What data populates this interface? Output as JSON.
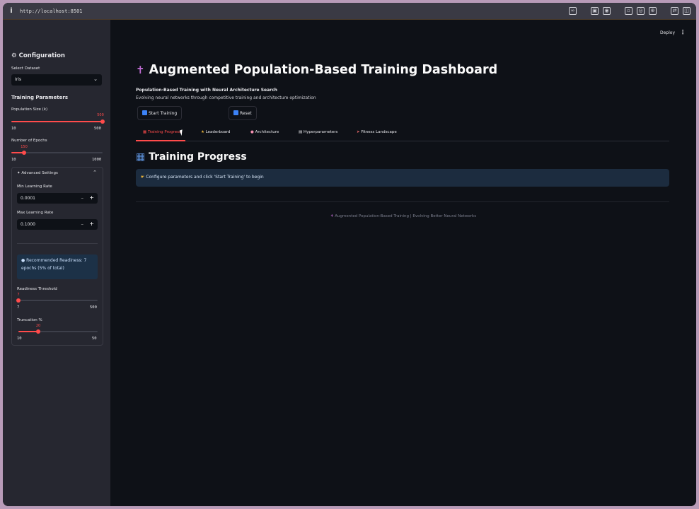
{
  "browser": {
    "url": "http://localhost:8501"
  },
  "header": {
    "deploy_label": "Deploy"
  },
  "sidebar": {
    "title": "Configuration",
    "dataset_label": "Select Dataset",
    "dataset_value": "Iris",
    "training_params_heading": "Training Parameters",
    "population": {
      "label": "Population Size (k)",
      "value": "500",
      "min": "10",
      "max": "500",
      "fraction": 1.0
    },
    "epochs": {
      "label": "Number of Epochs",
      "value": "150",
      "min": "10",
      "max": "1000",
      "fraction": 0.14
    },
    "advanced": {
      "title": "Advanced Settings",
      "min_lr_label": "Min Learning Rate",
      "min_lr_value": "0.0001",
      "max_lr_label": "Max Learning Rate",
      "max_lr_value": "0.1000",
      "readiness_info_line1": "Recommended Readiness: 7",
      "readiness_info_line2": "epochs (5% of total)",
      "readiness": {
        "label": "Readiness Threshold",
        "value": "7",
        "min": "7",
        "max": "500",
        "fraction": 0.0
      },
      "truncation": {
        "label": "Truncation %",
        "value": "20",
        "min": "10",
        "max": "50",
        "fraction": 0.25
      }
    }
  },
  "main": {
    "title": "Augmented Population-Based Training Dashboard",
    "subtitle": "Population-Based Training with Neural Architecture Search",
    "tagline": "Evolving neural networks through competitive training and architecture optimization",
    "start_button": "Start Training",
    "reset_button": "Reset",
    "tabs": [
      {
        "label": "Training Progress",
        "icon": "chart-icon"
      },
      {
        "label": "Leaderboard",
        "icon": "trophy-icon"
      },
      {
        "label": "Architecture",
        "icon": "brain-icon"
      },
      {
        "label": "Hyperparameters",
        "icon": "notebook-icon"
      },
      {
        "label": "Fitness Landscape",
        "icon": "rocket-icon"
      }
    ],
    "section_title": "Training Progress",
    "info_message": "Configure parameters and click 'Start Training' to begin",
    "footer": "Augmented Population-Based Training | Evolving Better Neural Networks"
  },
  "colors": {
    "accent": "#ff4b4b",
    "background": "#0e1117",
    "sidebar": "#262730",
    "info": "#1c2c3f"
  }
}
